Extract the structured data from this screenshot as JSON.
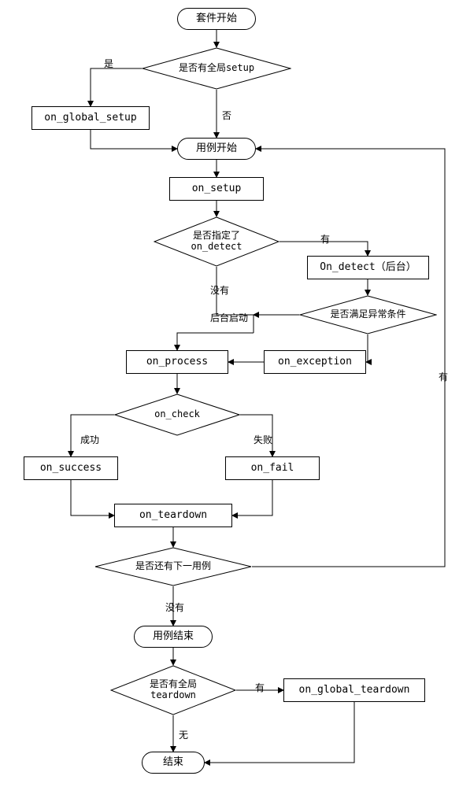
{
  "nodes": {
    "start": "套件开始",
    "q_global_setup": "是否有全局setup",
    "on_global_setup": "on_global_setup",
    "case_start": "用例开始",
    "on_setup": "on_setup",
    "q_on_detect": "是否指定了\non_detect",
    "on_detect_bg": "On_detect（后台）",
    "q_exception": "是否满足异常条件",
    "on_exception": "on_exception",
    "on_process": "on_process",
    "q_on_check": "on_check",
    "on_success": "on_success",
    "on_fail": "on_fail",
    "on_teardown": "on_teardown",
    "q_next_case": "是否还有下一用例",
    "case_end": "用例结束",
    "q_global_teardown": "是否有全局\nteardown",
    "on_global_teardown": "on_global_teardown",
    "end": "结束"
  },
  "edge_labels": {
    "yes": "是",
    "no": "否",
    "have": "有",
    "not_have": "没有",
    "bg_start": "后台启动",
    "success": "成功",
    "fail": "失败",
    "none": "无"
  },
  "chart_data": {
    "type": "flowchart",
    "title": "",
    "nodes": [
      {
        "id": "start",
        "type": "terminator",
        "label": "套件开始"
      },
      {
        "id": "q_global_setup",
        "type": "decision",
        "label": "是否有全局setup"
      },
      {
        "id": "on_global_setup",
        "type": "process",
        "label": "on_global_setup"
      },
      {
        "id": "case_start",
        "type": "terminator",
        "label": "用例开始"
      },
      {
        "id": "on_setup",
        "type": "process",
        "label": "on_setup"
      },
      {
        "id": "q_on_detect",
        "type": "decision",
        "label": "是否指定了 on_detect"
      },
      {
        "id": "on_detect_bg",
        "type": "process",
        "label": "On_detect（后台）"
      },
      {
        "id": "q_exception",
        "type": "decision",
        "label": "是否满足异常条件"
      },
      {
        "id": "on_exception",
        "type": "process",
        "label": "on_exception"
      },
      {
        "id": "on_process",
        "type": "process",
        "label": "on_process"
      },
      {
        "id": "q_on_check",
        "type": "decision",
        "label": "on_check"
      },
      {
        "id": "on_success",
        "type": "process",
        "label": "on_success"
      },
      {
        "id": "on_fail",
        "type": "process",
        "label": "on_fail"
      },
      {
        "id": "on_teardown",
        "type": "process",
        "label": "on_teardown"
      },
      {
        "id": "q_next_case",
        "type": "decision",
        "label": "是否还有下一用例"
      },
      {
        "id": "case_end",
        "type": "terminator",
        "label": "用例结束"
      },
      {
        "id": "q_global_teardown",
        "type": "decision",
        "label": "是否有全局 teardown"
      },
      {
        "id": "on_global_teardown",
        "type": "process",
        "label": "on_global_teardown"
      },
      {
        "id": "end",
        "type": "terminator",
        "label": "结束"
      }
    ],
    "edges": [
      {
        "from": "start",
        "to": "q_global_setup",
        "label": ""
      },
      {
        "from": "q_global_setup",
        "to": "on_global_setup",
        "label": "是"
      },
      {
        "from": "q_global_setup",
        "to": "case_start",
        "label": "否"
      },
      {
        "from": "on_global_setup",
        "to": "case_start",
        "label": ""
      },
      {
        "from": "case_start",
        "to": "on_setup",
        "label": ""
      },
      {
        "from": "on_setup",
        "to": "q_on_detect",
        "label": ""
      },
      {
        "from": "q_on_detect",
        "to": "on_detect_bg",
        "label": "有"
      },
      {
        "from": "q_on_detect",
        "to": "on_process",
        "label": "没有"
      },
      {
        "from": "on_detect_bg",
        "to": "q_exception",
        "label": ""
      },
      {
        "from": "q_exception",
        "to": "on_exception",
        "label": ""
      },
      {
        "from": "q_exception",
        "to": "on_process",
        "label": "后台启动"
      },
      {
        "from": "on_exception",
        "to": "on_process",
        "label": ""
      },
      {
        "from": "on_process",
        "to": "q_on_check",
        "label": ""
      },
      {
        "from": "q_on_check",
        "to": "on_success",
        "label": "成功"
      },
      {
        "from": "q_on_check",
        "to": "on_fail",
        "label": "失败"
      },
      {
        "from": "on_success",
        "to": "on_teardown",
        "label": ""
      },
      {
        "from": "on_fail",
        "to": "on_teardown",
        "label": ""
      },
      {
        "from": "on_teardown",
        "to": "q_next_case",
        "label": ""
      },
      {
        "from": "q_next_case",
        "to": "case_start",
        "label": "有"
      },
      {
        "from": "q_next_case",
        "to": "case_end",
        "label": "没有"
      },
      {
        "from": "case_end",
        "to": "q_global_teardown",
        "label": ""
      },
      {
        "from": "q_global_teardown",
        "to": "on_global_teardown",
        "label": "有"
      },
      {
        "from": "q_global_teardown",
        "to": "end",
        "label": "无"
      },
      {
        "from": "on_global_teardown",
        "to": "end",
        "label": ""
      }
    ]
  }
}
